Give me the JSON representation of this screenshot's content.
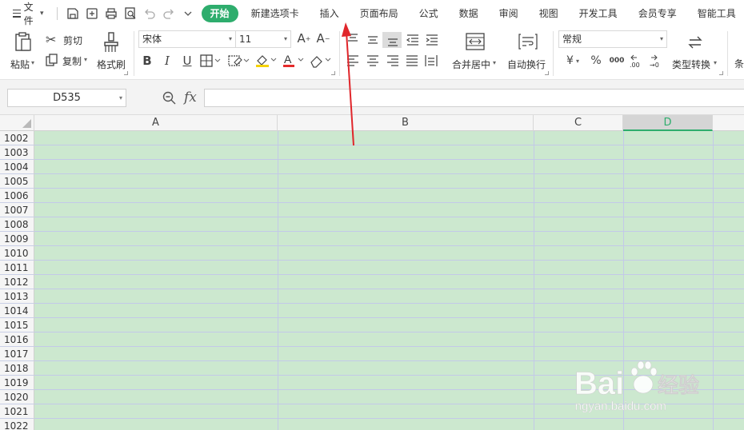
{
  "menubar": {
    "file_label": "文件",
    "tabs": [
      "开始",
      "新建选项卡",
      "插入",
      "页面布局",
      "公式",
      "数据",
      "审阅",
      "视图",
      "开发工具",
      "会员专享",
      "智能工具"
    ]
  },
  "ribbon": {
    "paste": "粘贴",
    "cut": "剪切",
    "copy": "复制",
    "format_painter": "格式刷",
    "font_name": "宋体",
    "font_size": "11",
    "merge_center": "合并居中",
    "wrap_text": "自动换行",
    "number_format": "常规",
    "type_convert": "类型转换",
    "condition_partial": "条",
    "currency_symbol": "¥",
    "percent_symbol": "%",
    "thousands_symbol": "000"
  },
  "formula_bar": {
    "name_box": "D535",
    "fx": "fx",
    "formula": ""
  },
  "grid": {
    "columns": [
      "A",
      "B",
      "C",
      "D"
    ],
    "selected_column": "D",
    "rows": [
      "1002",
      "1003",
      "1004",
      "1005",
      "1006",
      "1007",
      "1008",
      "1009",
      "1010",
      "1011",
      "1012",
      "1013",
      "1014",
      "1015",
      "1016",
      "1017",
      "1018",
      "1019",
      "1020",
      "1021",
      "1022"
    ],
    "cell_fill": "#cce8cf"
  },
  "watermark": {
    "brand": "Bai",
    "brand2": "经验",
    "url": "jingyan.baidu.com"
  },
  "colors": {
    "accent": "#2ead6d",
    "annotation_arrow": "#e0262b"
  }
}
